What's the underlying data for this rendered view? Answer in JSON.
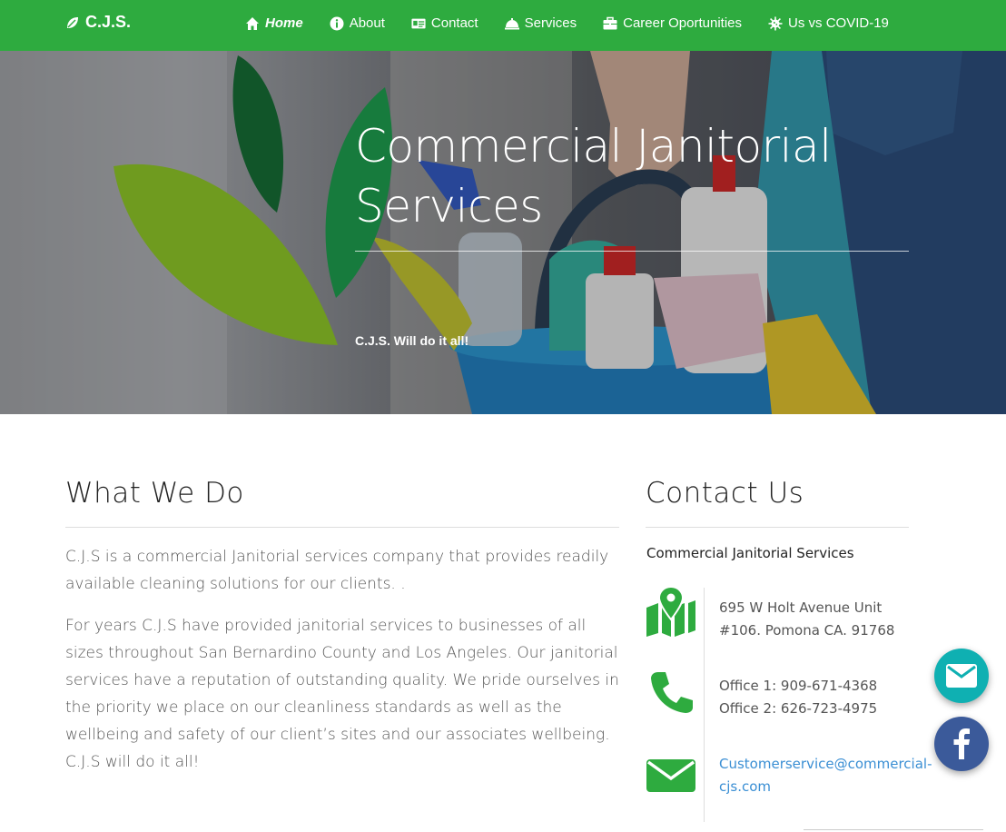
{
  "brand": {
    "name": "C.J.S.",
    "icon": "leaf-icon"
  },
  "nav": {
    "items": [
      {
        "label": "Home",
        "icon": "home-icon",
        "active": true
      },
      {
        "label": "About",
        "icon": "info-icon"
      },
      {
        "label": "Contact",
        "icon": "id-card-icon"
      },
      {
        "label": "Services",
        "icon": "service-bell-icon"
      },
      {
        "label": "Career Oportunities",
        "icon": "briefcase-icon"
      },
      {
        "label": "Us vs COVID-19",
        "icon": "virus-icon"
      }
    ]
  },
  "hero": {
    "title": "Commercial Janitorial Services",
    "subtitle": "C.J.S. Will do it all!"
  },
  "what_we_do": {
    "title": "What We Do",
    "paragraph1": "C.J.S is a commercial Janitorial services company that provides readily available cleaning solutions for our clients. .",
    "paragraph2": "For years C.J.S have provided janitorial services to businesses of all sizes throughout San Bernardino County and Los Angeles. Our janitorial services have a reputation of outstanding quality. We pride ourselves in the priority we place on our cleanliness standards as well as the wellbeing and safety of our client’s sites and our associates wellbeing. C.J.S will do it all!"
  },
  "contact": {
    "title": "Contact Us",
    "company": "Commercial Janitorial Services",
    "address_line1": "695 W Holt Avenue Unit",
    "address_line2": "#106. Pomona CA. 91768",
    "office1": "Office 1: 909-671-4368",
    "office2": "Office 2: 626-723-4975",
    "email_line1": "Customerservice@commercial-",
    "email_line2": "cjs.com",
    "icons": [
      "map-icon",
      "phone-icon",
      "envelope-icon"
    ]
  },
  "floating": {
    "mail_icon": "envelope-icon",
    "facebook_icon": "facebook-icon"
  },
  "colors": {
    "brand_green": "#2eab3f",
    "link_blue": "#3b8fd4",
    "mail_fab": "#0fb0b2",
    "facebook_fab": "#3b5a9a"
  }
}
